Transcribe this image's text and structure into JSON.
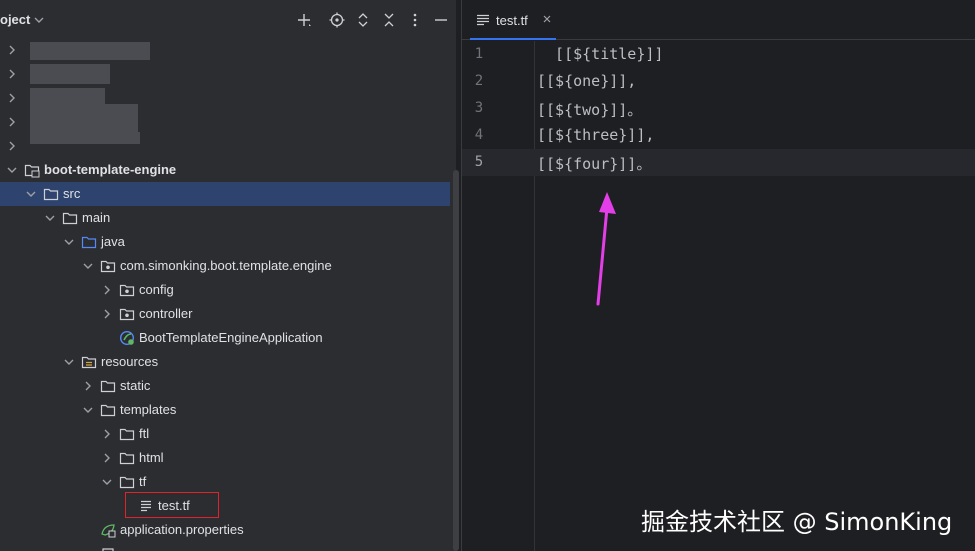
{
  "panel": {
    "title": "oject",
    "header_icons": [
      "add-icon",
      "locate-icon",
      "expand-all-icon",
      "collapse-all-icon",
      "more-options-icon",
      "hide-panel-icon"
    ]
  },
  "tree": {
    "items": [
      {
        "label": "boot-template-engine",
        "icon": "module-folder-icon",
        "expanded": true,
        "bold": true
      },
      {
        "label": "src",
        "icon": "folder-icon",
        "expanded": true,
        "selected": true
      },
      {
        "label": "main",
        "icon": "folder-icon",
        "expanded": true
      },
      {
        "label": "java",
        "icon": "source-folder-icon",
        "expanded": true
      },
      {
        "label": "com.simonking.boot.template.engine",
        "icon": "package-icon",
        "expanded": true
      },
      {
        "label": "config",
        "icon": "package-icon",
        "expanded": false
      },
      {
        "label": "controller",
        "icon": "package-icon",
        "expanded": false
      },
      {
        "label": "BootTemplateEngineApplication",
        "icon": "spring-class-icon"
      },
      {
        "label": "resources",
        "icon": "resources-folder-icon",
        "expanded": true
      },
      {
        "label": "static",
        "icon": "folder-icon",
        "expanded": false
      },
      {
        "label": "templates",
        "icon": "folder-icon",
        "expanded": true
      },
      {
        "label": "ftl",
        "icon": "folder-icon",
        "expanded": false
      },
      {
        "label": "html",
        "icon": "folder-icon",
        "expanded": false
      },
      {
        "label": "tf",
        "icon": "folder-icon",
        "expanded": true
      },
      {
        "label": "test.tf",
        "icon": "text-file-icon",
        "highlighted": true
      },
      {
        "label": "application.properties",
        "icon": "spring-properties-icon"
      }
    ]
  },
  "editor": {
    "tab": {
      "label": "test.tf",
      "icon": "text-file-icon",
      "active": true
    },
    "lines": [
      {
        "number": "1",
        "code": "  [[${title}]]"
      },
      {
        "number": "2",
        "code": "[[${one}]],"
      },
      {
        "number": "3",
        "code": "[[${two}]]。"
      },
      {
        "number": "4",
        "code": "[[${three}]],"
      },
      {
        "number": "5",
        "code": "[[${four}]]。",
        "current": true
      }
    ]
  },
  "watermark": "掘金技术社区 @ SimonKing",
  "colors": {
    "panel_bg": "#2b2d30",
    "editor_bg": "#1e1f22",
    "selection": "#2e436e",
    "accent": "#3574f0",
    "annotation_arrow": "#e43ee8",
    "annotation_box": "#e0242b"
  }
}
